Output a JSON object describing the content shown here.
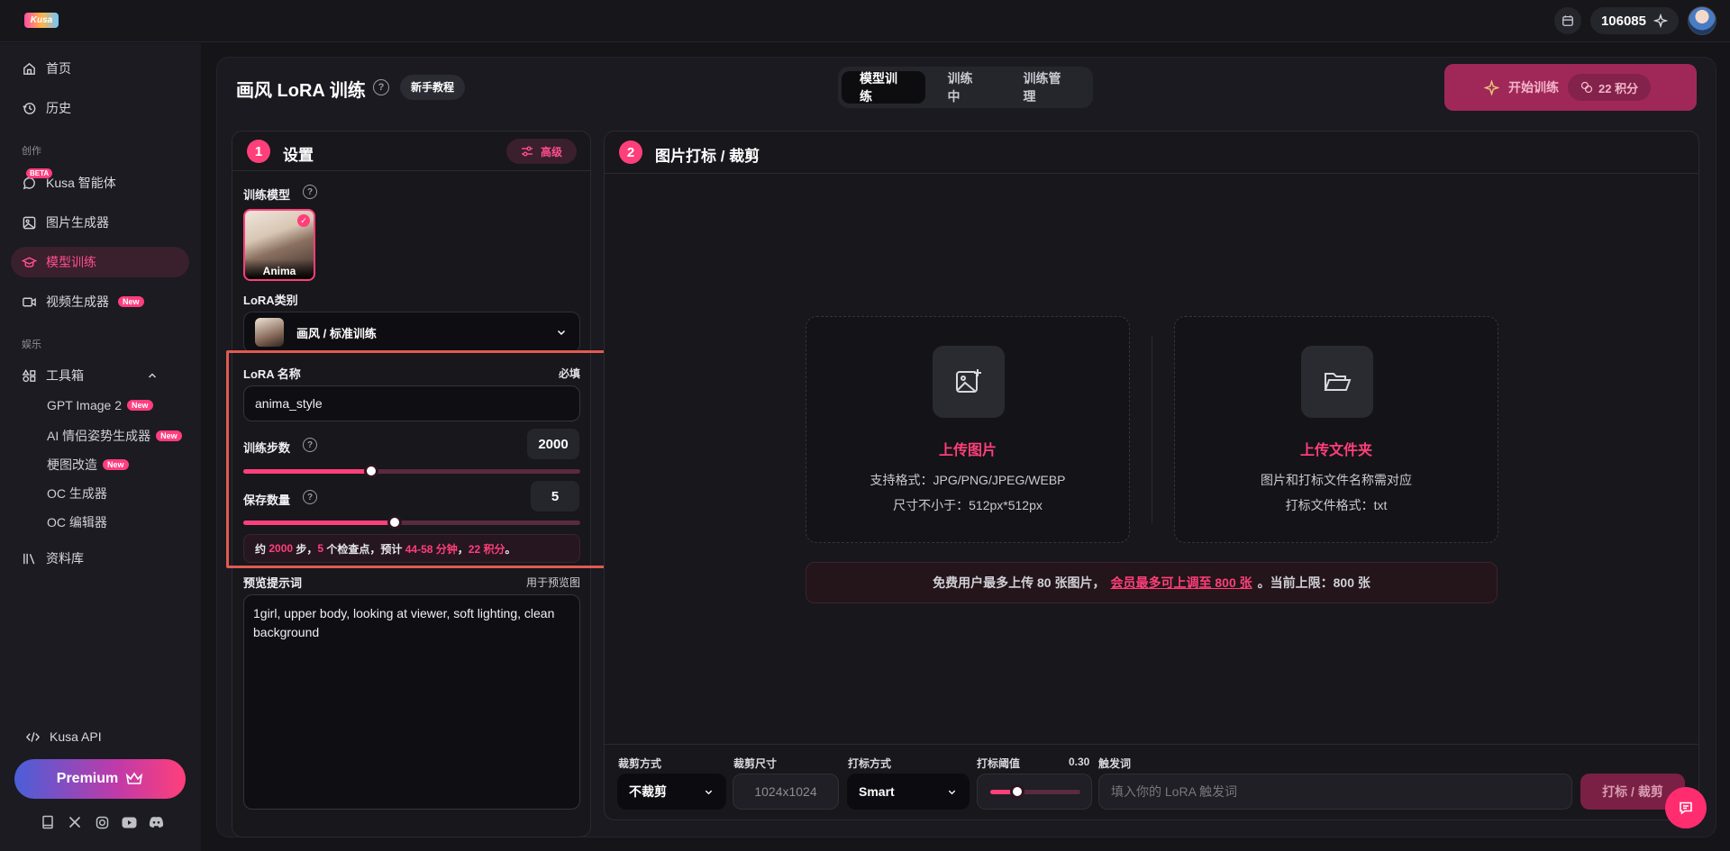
{
  "app": {
    "logo_text": "Kusa",
    "points": "106085"
  },
  "sidebar": {
    "home": "首页",
    "history": "历史",
    "section_create": "创作",
    "beta": "BETA",
    "agent": "Kusa 智能体",
    "image_gen": "图片生成器",
    "model_training": "模型训练",
    "video_gen": "视频生成器",
    "new_badge": "New",
    "section_fun": "娱乐",
    "toolbox": "工具箱",
    "tools": [
      {
        "label": "GPT Image 2",
        "is_new": true
      },
      {
        "label": "AI 情侣姿势生成器",
        "is_new": true
      },
      {
        "label": "梗图改造",
        "is_new": true
      },
      {
        "label": "OC 生成器",
        "is_new": false
      },
      {
        "label": "OC 编辑器",
        "is_new": false
      }
    ],
    "library": "资料库",
    "api": "Kusa API",
    "premium": "Premium"
  },
  "header": {
    "title": "画风 LoRA 训练",
    "tutorial": "新手教程",
    "tabs": [
      "模型训练",
      "训练中",
      "训练管理"
    ],
    "start_training": "开始训练",
    "cost": "22 积分"
  },
  "settings": {
    "step": "1",
    "title": "设置",
    "advanced": "高级",
    "model_label": "训练模型",
    "model_name": "Anima",
    "lora_type_label": "LoRA类别",
    "lora_type_value": "画风 / 标准训练",
    "lora_name_label": "LoRA 名称",
    "required": "必填",
    "lora_name_value": "anima_style",
    "steps_label": "训练步数",
    "steps_value": "2000",
    "steps_fraction": 0.38,
    "save_label": "保存数量",
    "save_value": "5",
    "save_fraction": 0.45,
    "estimate": {
      "p1": "约 ",
      "steps": "2000",
      "p2": " 步，",
      "checkpoints": "5",
      "p3": " 个检查点，预计 ",
      "time": "44-58 分钟",
      "p4": "，",
      "cost": "22 积分",
      "p5": "。"
    },
    "preview_label": "预览提示词",
    "preview_hint": "用于预览图",
    "preview_text": "1girl, upper body, looking at viewer, soft lighting, clean background"
  },
  "tagging": {
    "step": "2",
    "title": "图片打标 / 裁剪",
    "upload_images": {
      "title": "上传图片",
      "line1": "支持格式：JPG/PNG/JPEG/WEBP",
      "line2": "尺寸不小于：512px*512px"
    },
    "upload_folder": {
      "title": "上传文件夹",
      "line1": "图片和打标文件名称需对应",
      "line2": "打标文件格式：txt"
    },
    "limit": {
      "text1": "免费用户最多上传 80 张图片，",
      "link": "会员最多可上调至 800 张",
      "text2": "。当前上限：800 张"
    },
    "crop_mode_label": "裁剪方式",
    "crop_mode_value": "不裁剪",
    "crop_size_label": "裁剪尺寸",
    "crop_size_value": "1024x1024",
    "tag_mode_label": "打标方式",
    "tag_mode_value": "Smart",
    "threshold_label": "打标阈值",
    "threshold_value": "0.30",
    "threshold_fraction": 0.3,
    "trigger_label": "触发词",
    "trigger_placeholder": "填入你的 LoRA 触发词",
    "tag_button": "打标 / 裁剪"
  },
  "colors": {
    "accent": "#ff3f7a",
    "bg": "#141419",
    "panel": "#17171c"
  }
}
